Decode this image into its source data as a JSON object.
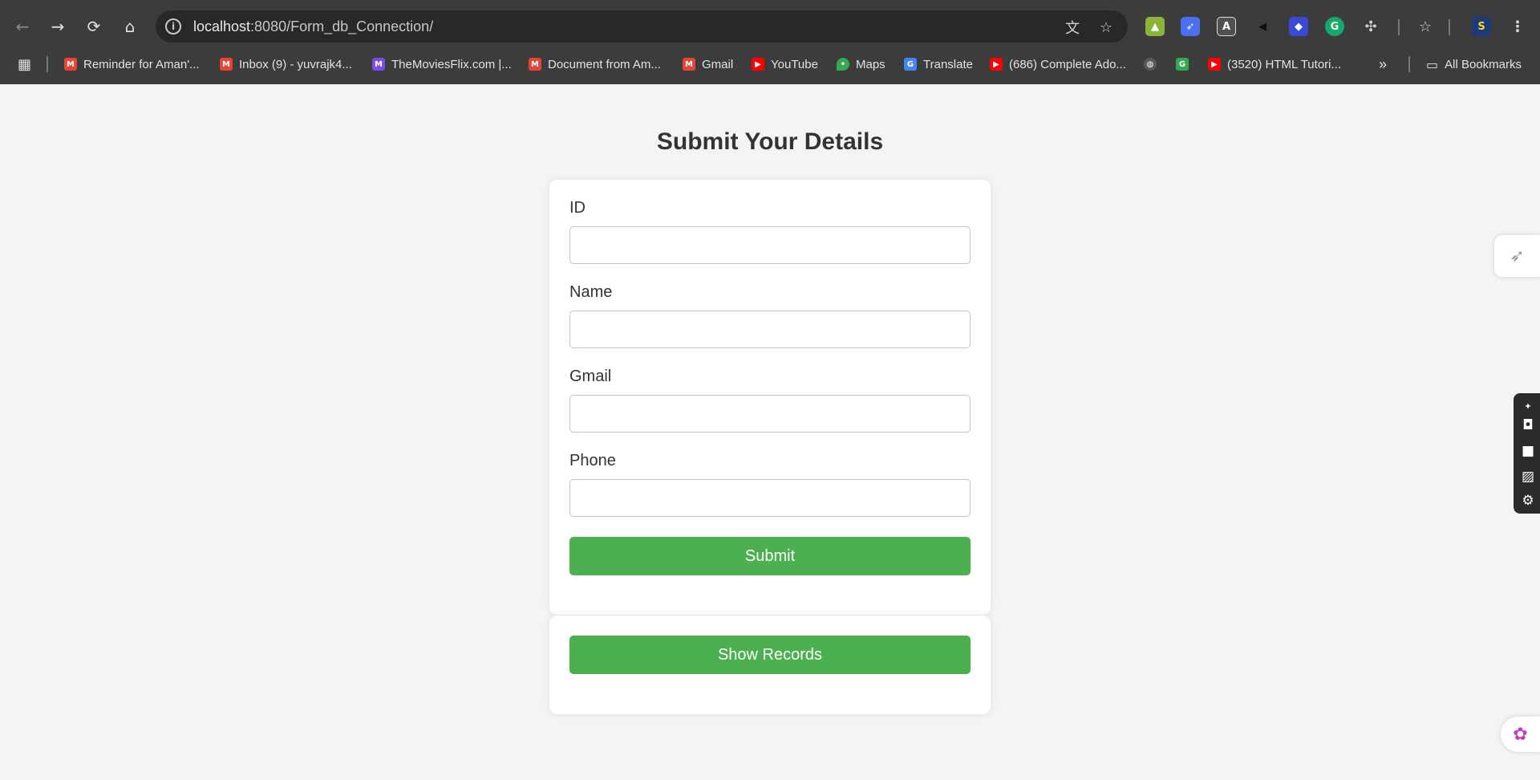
{
  "browser": {
    "url_host": "localhost",
    "url_rest": ":8080/Form_db_Connection/",
    "nav": {
      "back": "←",
      "forward": "→",
      "reload": "⟳",
      "home": "⌂"
    },
    "bookmarks": [
      {
        "label": "Reminder for Aman'...",
        "icon": "gmail-icon"
      },
      {
        "label": "Inbox (9) - yuvrajk4...",
        "icon": "gmail-icon"
      },
      {
        "label": "TheMoviesFlix.com |...",
        "icon": "moviesflix-icon"
      },
      {
        "label": "Document from Am...",
        "icon": "gmail-icon"
      },
      {
        "label": "Gmail",
        "icon": "gmail-icon"
      },
      {
        "label": "YouTube",
        "icon": "youtube-icon"
      },
      {
        "label": "Maps",
        "icon": "maps-icon"
      },
      {
        "label": "Translate",
        "icon": "translate-icon"
      },
      {
        "label": "(686) Complete Ado...",
        "icon": "youtube-icon"
      },
      {
        "label": "(3520) HTML Tutori...",
        "icon": "youtube-icon"
      }
    ],
    "all_bookmarks": "All Bookmarks",
    "overflow": "»"
  },
  "page": {
    "title": "Submit Your Details",
    "fields": {
      "id_label": "ID",
      "name_label": "Name",
      "gmail_label": "Gmail",
      "phone_label": "Phone"
    },
    "submit_label": "Submit",
    "show_records_label": "Show Records"
  },
  "colors": {
    "button_green": "#4caf50",
    "page_bg": "#f4f4f4",
    "chrome_bg": "#3c3c3c"
  }
}
